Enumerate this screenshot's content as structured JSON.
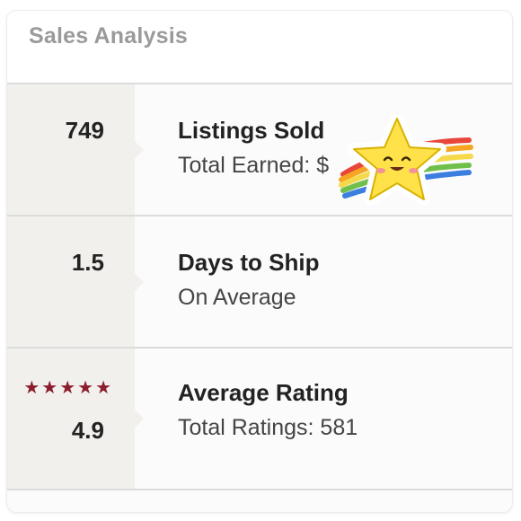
{
  "card": {
    "title": "Sales Analysis"
  },
  "rows": [
    {
      "value": "749",
      "title": "Listings Sold",
      "subtitle": "Total Earned: $"
    },
    {
      "value": "1.5",
      "title": "Days to Ship",
      "subtitle": "On Average"
    },
    {
      "value": "4.9",
      "title": "Average Rating",
      "subtitle": "Total Ratings: 581",
      "stars": 5
    }
  ],
  "colors": {
    "star": "#8b1d2c",
    "left_panel": "#f1f0ec",
    "divider": "#dcdcdc"
  },
  "icons": {
    "rating": "star-icon",
    "sticker": "shooting-star-sticker-icon"
  }
}
